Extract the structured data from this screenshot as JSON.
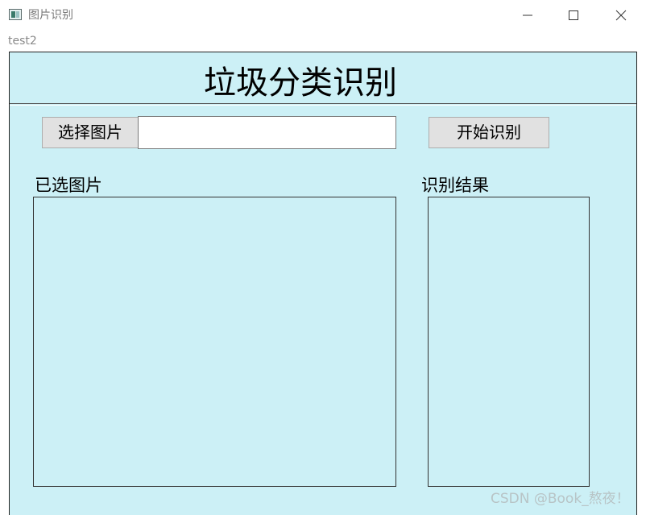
{
  "window": {
    "title": "图片识别",
    "menu_label": "test2"
  },
  "header": {
    "title": "垃圾分类识别"
  },
  "controls": {
    "choose_image_label": "选择图片",
    "path_value": "",
    "start_label": "开始识别"
  },
  "panels": {
    "selected_image_label": "已选图片",
    "result_label": "识别结果"
  },
  "watermark": "CSDN @Book_熬夜！",
  "colors": {
    "client_background": "#ccf0f6",
    "button_background": "#e1e1e1"
  },
  "icons": [
    "app-icon",
    "minimize-icon",
    "maximize-icon",
    "close-icon"
  ]
}
